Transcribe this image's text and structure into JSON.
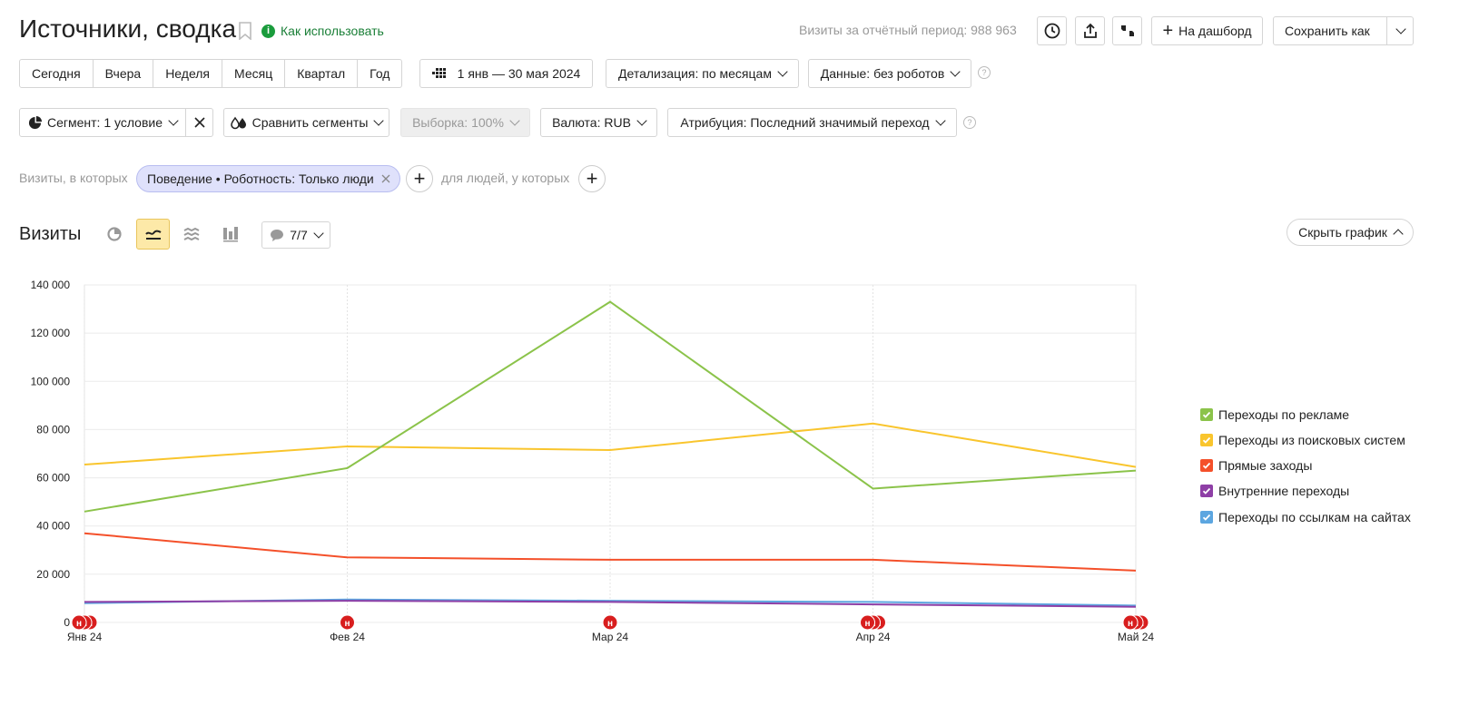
{
  "header": {
    "title": "Источники, сводка",
    "how_to_use": "Как использовать",
    "visits_label": "Визиты за отчётный период: 988 963",
    "to_dashboard": "На дашборд",
    "save_as": "Сохранить как"
  },
  "periods": [
    "Сегодня",
    "Вчера",
    "Неделя",
    "Месяц",
    "Квартал",
    "Год"
  ],
  "date_range": "1 янв — 30 мая 2024",
  "detail": "Детализация: по месяцам",
  "data_filter": "Данные: без роботов",
  "segment": "Сегмент: 1 условие",
  "compare": "Сравнить сегменты",
  "sample": "Выборка: 100%",
  "currency": "Валюта: RUB",
  "attribution": "Атрибуция: Последний значимый переход",
  "filter_row": {
    "visits_label": "Визиты, в которых",
    "chip": "Поведение • Роботность: Только люди",
    "people_label": "для людей, у которых"
  },
  "chart_header": {
    "title": "Визиты",
    "series_count": "7/7",
    "hide": "Скрыть график"
  },
  "colors": {
    "green": "#8bc34a",
    "yellow": "#f9c52d",
    "red": "#f4502a",
    "purple": "#8e3fa6",
    "blue": "#5ca6e0",
    "accent": "#fde9a8",
    "chip": "#dfe1fb"
  },
  "chart_data": {
    "type": "line",
    "categories": [
      "Янв 24",
      "Фев 24",
      "Мар 24",
      "Апр 24",
      "Май 24"
    ],
    "ylim": [
      0,
      140000
    ],
    "yticks": [
      "0",
      "20 000",
      "40 000",
      "60 000",
      "80 000",
      "100 000",
      "120 000",
      "140 000"
    ],
    "grid": true,
    "legend_position": "right",
    "series": [
      {
        "name": "Переходы по рекламе",
        "color": "#8bc34a",
        "values": [
          46000,
          64000,
          133000,
          55500,
          63000
        ]
      },
      {
        "name": "Переходы из поисковых систем",
        "color": "#f9c52d",
        "values": [
          65500,
          73000,
          71500,
          82500,
          64500
        ]
      },
      {
        "name": "Прямые заходы",
        "color": "#f4502a",
        "values": [
          37000,
          27000,
          26000,
          26000,
          21500
        ]
      },
      {
        "name": "Внутренние переходы",
        "color": "#8e3fa6",
        "values": [
          8500,
          9000,
          8500,
          7500,
          6500
        ]
      },
      {
        "name": "Переходы по ссылкам на сайтах",
        "color": "#5ca6e0",
        "values": [
          8000,
          9500,
          9000,
          8500,
          7000
        ]
      }
    ],
    "annotation_marker": "н"
  }
}
